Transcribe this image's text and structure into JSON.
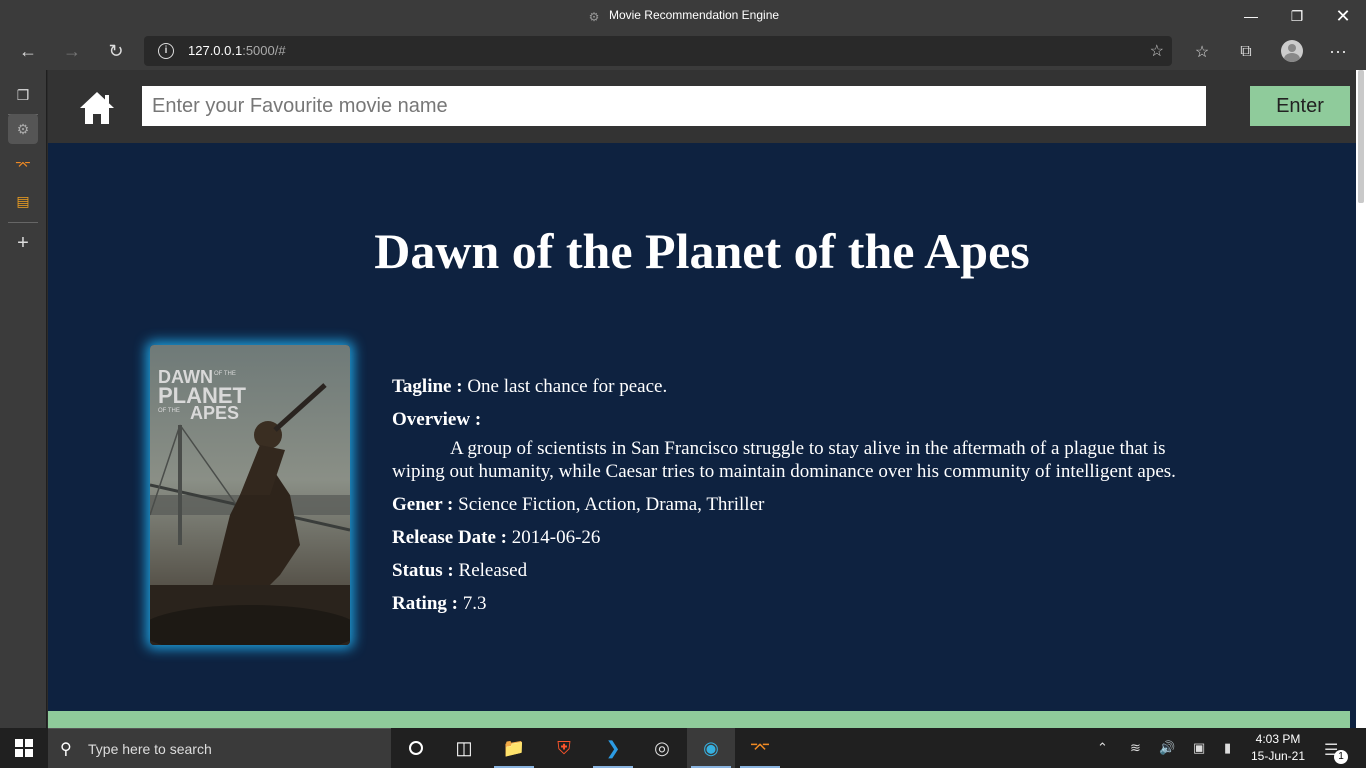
{
  "window": {
    "title": "Movie Recommendation Engine"
  },
  "browser": {
    "url_host": "127.0.0.1",
    "url_rest": ":5000/#"
  },
  "site": {
    "search_placeholder": "Enter your Favourite movie name",
    "enter_label": "Enter"
  },
  "movie": {
    "title": "Dawn of the Planet of the Apes",
    "poster_title_line1": "DAWN",
    "poster_title_small": "OF THE",
    "poster_title_line2": "PLANET",
    "poster_title_small2": "OF THE",
    "poster_title_line3": "APES",
    "tagline_label": "Tagline :",
    "tagline": "One last chance for peace.",
    "overview_label": "Overview :",
    "overview": "A group of scientists in San Francisco struggle to stay alive in the aftermath of a plague that is wiping out humanity, while Caesar tries to maintain dominance over his community of intelligent apes.",
    "genre_label": "Gener :",
    "genre": "Science Fiction, Action, Drama, Thriller",
    "release_label": "Release Date :",
    "release_date": "2014-06-26",
    "status_label": "Status :",
    "status": "Released",
    "rating_label": "Rating :",
    "rating": "7.3"
  },
  "taskbar": {
    "search_text": "Type here to search",
    "time": "4:03 PM",
    "date": "15-Jun-21",
    "notification_count": "1"
  },
  "colors": {
    "page_background": "#0e2240",
    "navbar": "#333333",
    "accent_green": "#8fcb9b",
    "poster_glow": "#1e9ad6"
  }
}
